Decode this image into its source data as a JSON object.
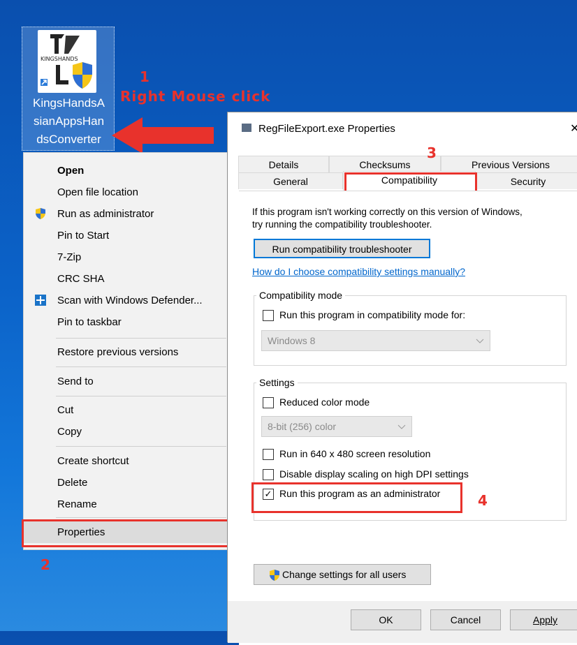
{
  "desktop": {
    "icon_label_lines": [
      "KingsHandsA",
      "sianAppsHan",
      "dsConverter"
    ],
    "icon_brand_text": "KINGSHANDS"
  },
  "annotations": {
    "step1_number": "1",
    "step1_text": "Right Mouse click",
    "step2_number": "2",
    "step3_number": "3",
    "step4_number": "4"
  },
  "context_menu": {
    "items": [
      {
        "label": "Open",
        "icon": "none"
      },
      {
        "label": "Open file location",
        "icon": "none"
      },
      {
        "label": "Run as administrator",
        "icon": "uac-shield-icon"
      },
      {
        "label": "Pin to Start",
        "icon": "none"
      },
      {
        "label": "7-Zip",
        "icon": "none"
      },
      {
        "label": "CRC SHA",
        "icon": "none"
      },
      {
        "label": "Scan with Windows Defender...",
        "icon": "defender-icon"
      },
      {
        "label": "Pin to taskbar",
        "icon": "none"
      },
      {
        "label": "Restore previous versions",
        "icon": "none"
      },
      {
        "label": "Send to",
        "icon": "none"
      },
      {
        "label": "Cut",
        "icon": "none"
      },
      {
        "label": "Copy",
        "icon": "none"
      },
      {
        "label": "Create shortcut",
        "icon": "none"
      },
      {
        "label": "Delete",
        "icon": "none"
      },
      {
        "label": "Rename",
        "icon": "none"
      },
      {
        "label": "Properties",
        "icon": "none"
      }
    ]
  },
  "dialog": {
    "title": "RegFileExport.exe Properties",
    "close_glyph": "✕",
    "tabs_row1": [
      "Details",
      "Checksums",
      "Previous Versions"
    ],
    "tabs_row2": [
      "General",
      "Compatibility",
      "Security"
    ],
    "active_tab": "Compatibility",
    "intro_text_line1": "If this program isn't working correctly on this version of Windows,",
    "intro_text_line2": "try running the compatibility troubleshooter.",
    "troubleshooter_button": "Run compatibility troubleshooter",
    "help_link": "How do I choose compatibility settings manually?",
    "compat_mode": {
      "group_label": "Compatibility mode",
      "checkbox_label": "Run this program in compatibility mode for:",
      "checked": false,
      "os_select_value": "Windows 8"
    },
    "settings": {
      "group_label": "Settings",
      "reduced_color_label": "Reduced color mode",
      "reduced_color_checked": false,
      "color_select_value": "8-bit (256) color",
      "res640_label": "Run in 640 x 480 screen resolution",
      "res640_checked": false,
      "dpi_label": "Disable display scaling on high DPI settings",
      "dpi_checked": false,
      "admin_label": "Run this program as an administrator",
      "admin_checked": true,
      "admin_check_glyph": "✓"
    },
    "change_all_users_button": "Change settings for all users",
    "ok_button": "OK",
    "cancel_button": "Cancel",
    "apply_button": "Apply"
  },
  "colors": {
    "accent_red": "#e8322c",
    "desktop_blue": "#0b62c8",
    "link_blue": "#0066cc"
  }
}
